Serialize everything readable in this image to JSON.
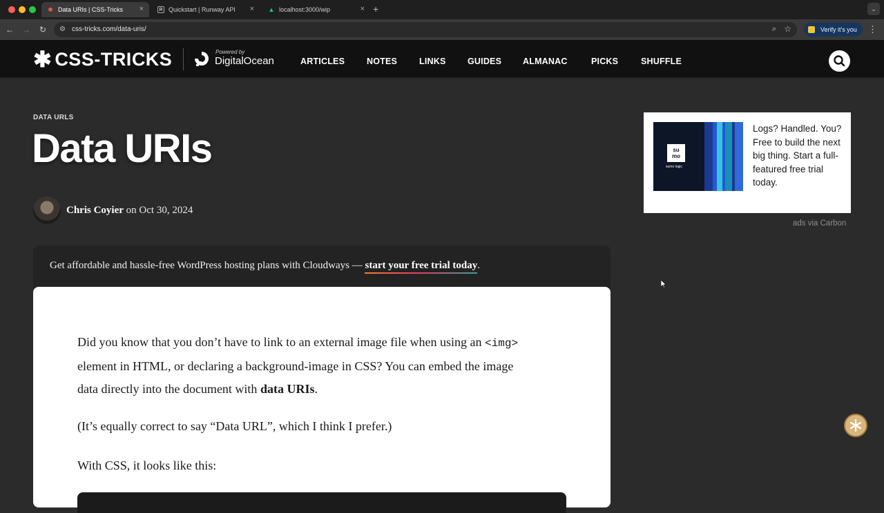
{
  "browser": {
    "tabs": [
      {
        "label": "Data URIs | CSS-Tricks",
        "favicon": "css-tricks-asterisk-icon",
        "active": true
      },
      {
        "label": "Quickstart | Runway API",
        "favicon": "runway-icon",
        "active": false
      },
      {
        "label": "localhost:3000/wip",
        "favicon": "nuxt-icon",
        "active": false
      }
    ],
    "new_tab": "+",
    "url": "css-tricks.com/data-uris/",
    "verify_label": "Verify it's you"
  },
  "header": {
    "logo_text": "CSS-TRICKS",
    "powered_by": "Powered by",
    "sponsor": "DigitalOcean",
    "nav": [
      "ARTICLES",
      "NOTES",
      "LINKS",
      "GUIDES",
      "ALMANAC",
      "PICKS",
      "SHUFFLE"
    ]
  },
  "article": {
    "eyebrow": "DATA URLS",
    "title": "Data URIs",
    "author": "Chris Coyier",
    "date_prefix": "on",
    "date": "Oct 30, 2024",
    "promo_text": "Get affordable and hassle-free WordPress hosting plans with Cloudways — ",
    "promo_link": "start your free trial today",
    "promo_end": ".",
    "p1_a": "Did you know that you don’t have to link to an external image file when using an ",
    "p1_code": "<img>",
    "p1_b": "element in HTML, or declaring a background-image in CSS? You can embed the image",
    "p1_c": "data directly into the document with ",
    "p1_bold": "data URIs",
    "p1_end": ".",
    "p2": "(It’s equally correct to say “Data URL”, which I think I prefer.)",
    "p3": "With CSS, it looks like this:"
  },
  "ad": {
    "logo_line1": "su",
    "logo_line2": "mo",
    "logo_tag": "sumo logic",
    "text": "Logs? Handled. You? Free to build the next big thing. Start a full-featured free trial today.",
    "via": "ads via Carbon"
  },
  "colors": {
    "header_bg": "#111111",
    "page_bg": "#2b2b2b",
    "promo_gradient": [
      "#ff7a2f",
      "#e43b6b",
      "#3aa6a1"
    ]
  }
}
